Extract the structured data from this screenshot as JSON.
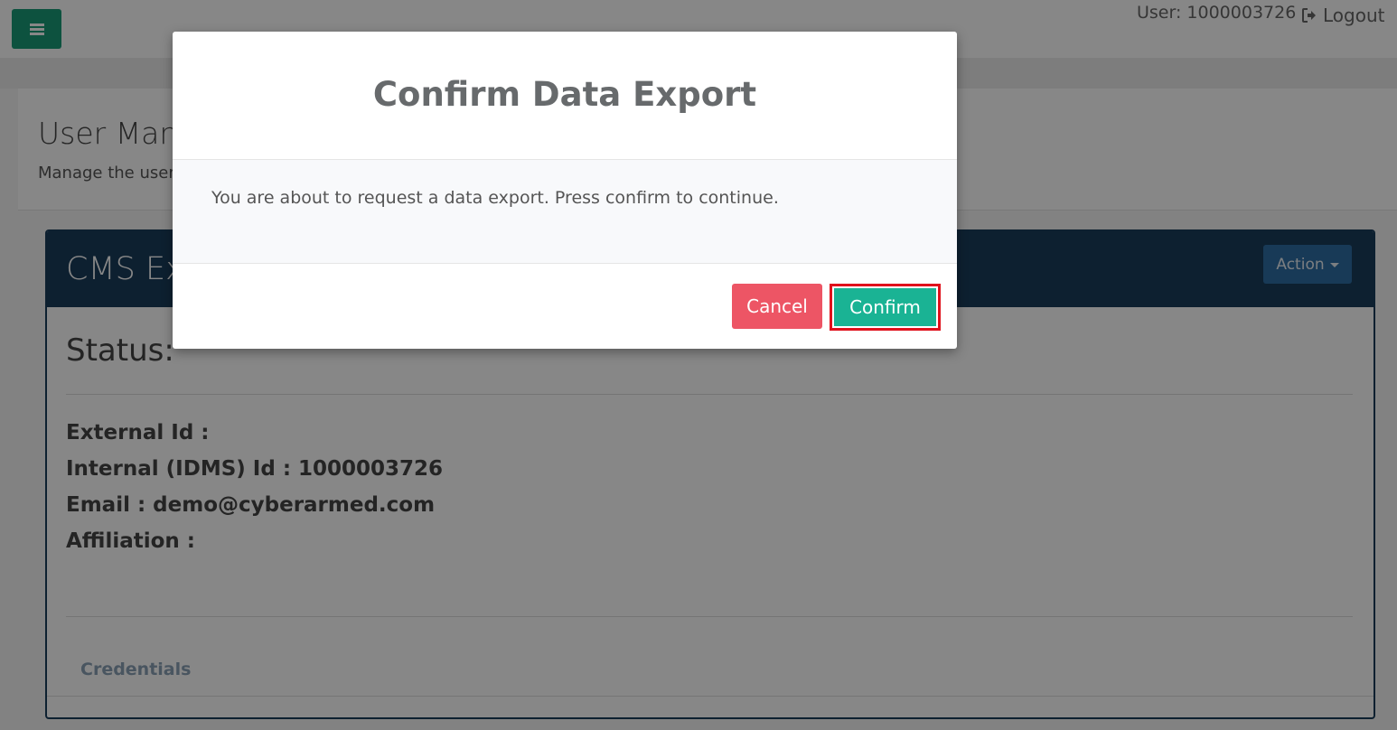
{
  "header": {
    "user_label": "User: 1000003726",
    "logout_label": "Logout"
  },
  "page": {
    "title": "User Man",
    "description": "Manage the user"
  },
  "panel": {
    "title": "CMS Exp",
    "action_label": "Action",
    "status_label": "Status:",
    "fields": [
      "External Id :",
      "Internal (IDMS) Id : 1000003726",
      "Email : demo@cyberarmed.com",
      "Affiliation :"
    ],
    "tab_label": "Credentials"
  },
  "modal": {
    "title": "Confirm Data Export",
    "message": "You are about to request a data export. Press confirm to continue.",
    "cancel_label": "Cancel",
    "confirm_label": "Confirm"
  },
  "colors": {
    "brand_green": "#1a9b78",
    "panel_navy": "#1a3d5c",
    "cancel_red": "#ed5565",
    "confirm_green": "#1ab394",
    "highlight_red": "#e0111c"
  },
  "icons": {
    "menu": "hamburger-icon",
    "logout": "sign-out-icon",
    "action": "caret-down-icon"
  }
}
